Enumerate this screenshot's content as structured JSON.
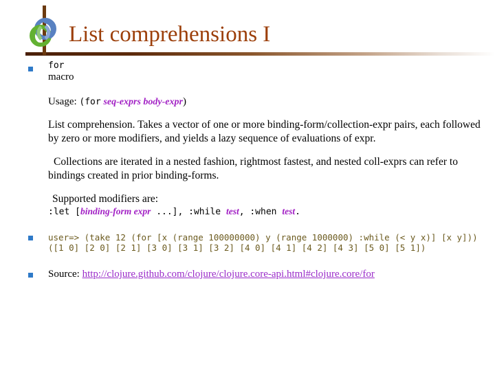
{
  "slide": {
    "title": "List comprehensions I",
    "logo_icon": "clojure-logo-icon",
    "accent_color": "#9c3f0a",
    "bullet_color": "#2f7ac8",
    "param_color": "#a11fc4",
    "link_color": "#9a2bc9",
    "code_color": "#6b5a1e"
  },
  "doc": {
    "symbol": "for",
    "kind": "macro",
    "usage_label": "Usage:",
    "usage_open": "(for",
    "usage_params": "seq-exprs body-expr",
    "usage_close": ")",
    "description": "List comprehension. Takes a vector of one or more binding-form/collection-expr pairs, each followed by zero or more modifiers, and yields a lazy sequence of evaluations of expr.",
    "collections": "Collections are iterated in a nested fashion, rightmost fastest, and nested coll-exprs can refer to bindings created in prior binding-forms.",
    "modifiers_title": "Supported modifiers are:",
    "modifiers": {
      "let_keyword": ":let",
      "let_open": "[",
      "let_params": "binding-form expr",
      "let_ellipsis": "...",
      "let_close": "],",
      "while_keyword": ":while",
      "while_param": "test",
      "while_sep": ",",
      "when_keyword": ":when",
      "when_param": "test",
      "when_end": "."
    }
  },
  "example": {
    "prompt": "user=>",
    "input": " (take 12 (for [x (range 100000000) y (range 1000000) :while (< y x)] [x y]))",
    "output": "([1 0] [2 0] [2 1] [3 0] [3 1] [3 2] [4 0] [4 1] [4 2] [4 3] [5 0] [5 1])"
  },
  "source": {
    "label": "Source:",
    "url": "http://clojure.github.com/clojure/clojure.core-api.html#clojure.core/for"
  }
}
